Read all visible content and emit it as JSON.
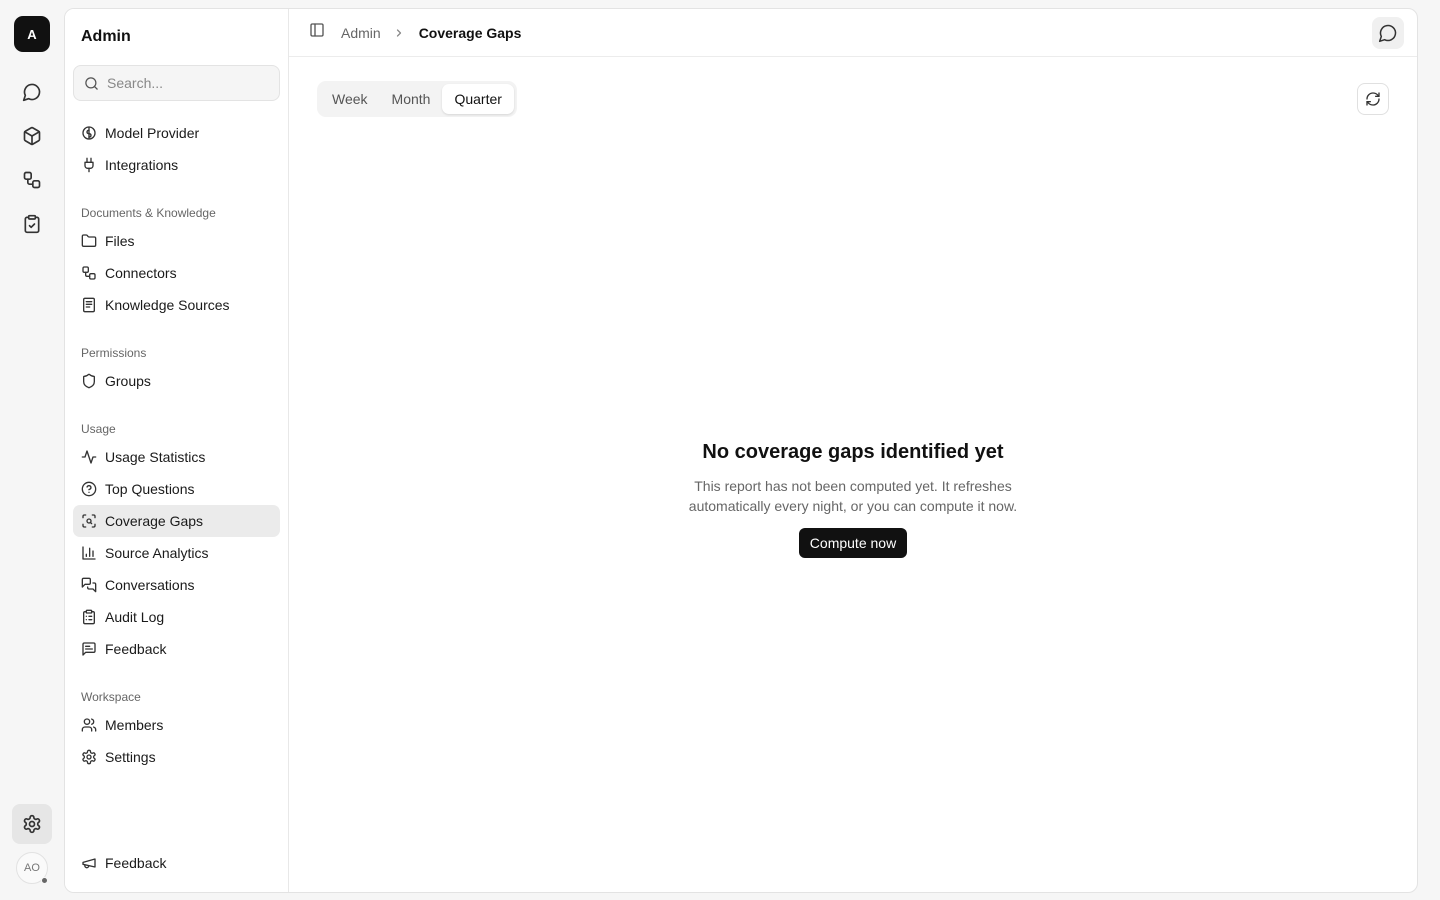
{
  "rail": {
    "logo_letter": "A",
    "avatar_initials": "AO"
  },
  "sidebar": {
    "title": "Admin",
    "search_placeholder": "Search...",
    "top_items": [
      {
        "label": "Model Provider",
        "icon": "brain-icon"
      },
      {
        "label": "Integrations",
        "icon": "plug-icon"
      }
    ],
    "sections": [
      {
        "title": "Documents & Knowledge",
        "items": [
          {
            "label": "Files",
            "icon": "folder-icon"
          },
          {
            "label": "Connectors",
            "icon": "connector-icon"
          },
          {
            "label": "Knowledge Sources",
            "icon": "book-icon"
          }
        ]
      },
      {
        "title": "Permissions",
        "items": [
          {
            "label": "Groups",
            "icon": "shield-icon"
          }
        ]
      },
      {
        "title": "Usage",
        "items": [
          {
            "label": "Usage Statistics",
            "icon": "activity-icon"
          },
          {
            "label": "Top Questions",
            "icon": "help-circle-icon"
          },
          {
            "label": "Coverage Gaps",
            "icon": "scan-search-icon",
            "active": true
          },
          {
            "label": "Source Analytics",
            "icon": "bar-chart-icon"
          },
          {
            "label": "Conversations",
            "icon": "messages-icon"
          },
          {
            "label": "Audit Log",
            "icon": "clipboard-list-icon"
          },
          {
            "label": "Feedback",
            "icon": "message-square-text-icon"
          }
        ]
      },
      {
        "title": "Workspace",
        "items": [
          {
            "label": "Members",
            "icon": "users-icon"
          },
          {
            "label": "Settings",
            "icon": "gear-icon"
          }
        ]
      }
    ],
    "footer_item": {
      "label": "Feedback",
      "icon": "megaphone-icon"
    }
  },
  "breadcrumb": {
    "parent": "Admin",
    "current": "Coverage Gaps"
  },
  "tabs": [
    {
      "label": "Week",
      "active": false
    },
    {
      "label": "Month",
      "active": false
    },
    {
      "label": "Quarter",
      "active": true
    }
  ],
  "empty_state": {
    "title": "No coverage gaps identified yet",
    "description": "This report has not been computed yet. It refreshes automatically every night, or you can compute it now.",
    "button_label": "Compute now"
  }
}
